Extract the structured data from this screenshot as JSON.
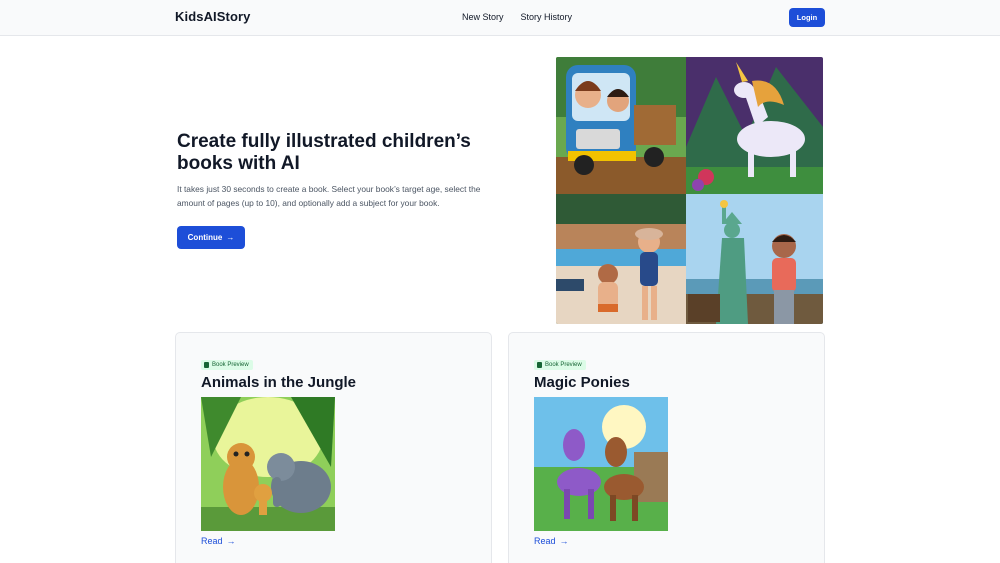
{
  "header": {
    "brand": "KidsAIStory",
    "nav": [
      {
        "label": "New Story"
      },
      {
        "label": "Story History"
      }
    ],
    "login_label": "Login"
  },
  "hero": {
    "title": "Create fully illustrated children’s books with AI",
    "description": "It takes just 30 seconds to create a book. Select your book’s target age, select the amount of pages (up to 10), and optionally add a subject for your book.",
    "continue_label": "Continue",
    "arrow": "→"
  },
  "cards": [
    {
      "badge": "Book Preview",
      "title": "Animals in the Jungle",
      "read_label": "Read",
      "arrow": "→"
    },
    {
      "badge": "Book Preview",
      "title": "Magic Ponies",
      "read_label": "Read",
      "arrow": "→"
    }
  ],
  "colors": {
    "accent": "#1d4ed8",
    "badge_bg": "#dcfce7",
    "badge_text": "#166534"
  },
  "icons": {
    "arrow": "arrow-right-icon",
    "badge": "book-icon"
  }
}
